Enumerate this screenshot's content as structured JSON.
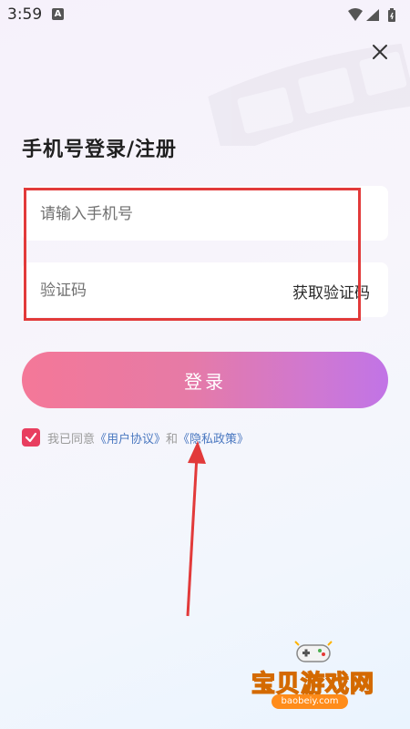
{
  "status_bar": {
    "time": "3:59",
    "notification_badge": "A"
  },
  "page": {
    "title": "手机号登录/注册"
  },
  "form": {
    "phone_placeholder": "请输入手机号",
    "code_placeholder": "验证码",
    "get_code_label": "获取验证码",
    "login_label": "登录"
  },
  "agreement": {
    "prefix": "我已同意",
    "user_agreement": "《用户协议》",
    "and": "和",
    "privacy_policy": "《隐私政策》",
    "checked": true
  },
  "watermark": {
    "name": "宝贝游戏网",
    "url": "baobeiy.com"
  },
  "colors": {
    "accent_pink": "#f47898",
    "accent_purple": "#c174e6",
    "checkbox": "#e83e5f",
    "link": "#4a78c0",
    "annotation_red": "#e23a3a"
  },
  "icons": [
    "wifi-icon",
    "signal-icon",
    "battery-icon",
    "close-icon",
    "check-icon",
    "gamepad-icon"
  ]
}
